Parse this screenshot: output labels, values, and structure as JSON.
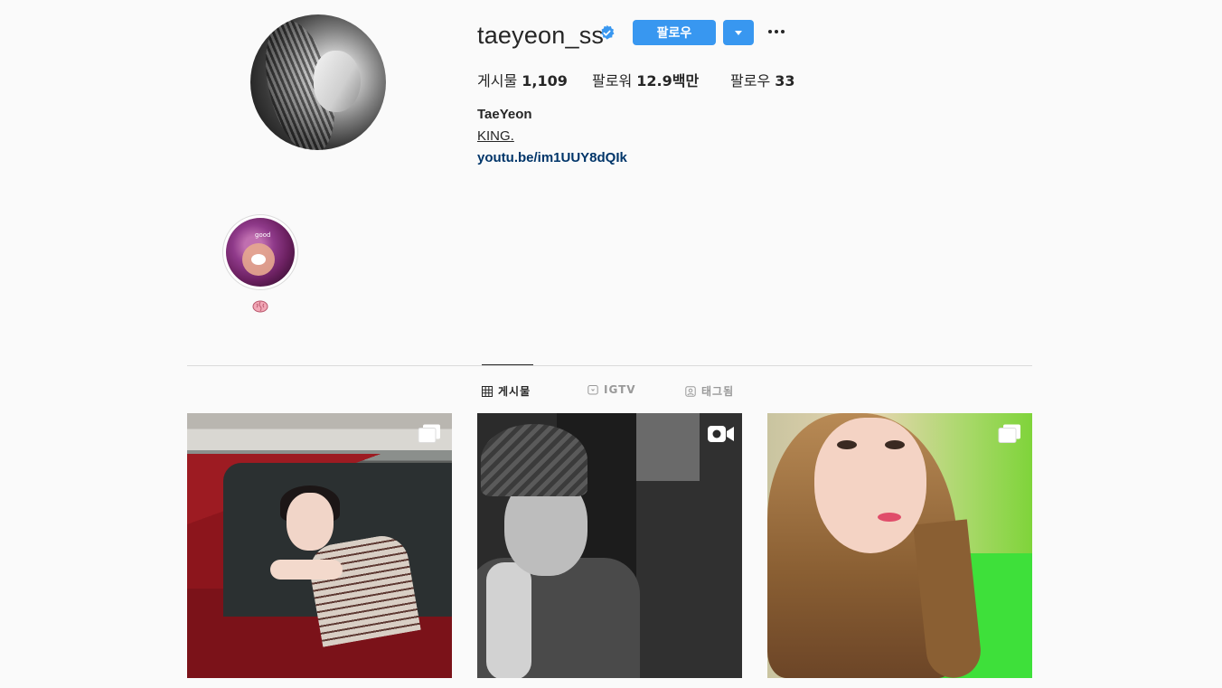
{
  "profile": {
    "username": "taeyeon_ss",
    "follow_label": "팔로우",
    "stats": {
      "posts_label": "게시물",
      "posts_value": "1,109",
      "followers_label": "팔로워",
      "followers_value": "12.9백만",
      "following_label": "팔로우",
      "following_value": "33"
    },
    "full_name": "TaeYeon",
    "bio": "KING.",
    "link": "youtu.be/im1UUY8dQIk"
  },
  "highlight": {
    "image_text": "good",
    "label_icon": "brain-emoji"
  },
  "tabs": [
    {
      "label": "게시물",
      "icon": "grid-icon",
      "active": true
    },
    {
      "label": "IGTV",
      "icon": "igtv-icon",
      "active": false
    },
    {
      "label": "태그됨",
      "icon": "tagged-icon",
      "active": false
    }
  ],
  "posts": [
    {
      "badge": "carousel-icon"
    },
    {
      "badge": "video-icon"
    },
    {
      "badge": "carousel-icon"
    }
  ],
  "colors": {
    "accent": "#3897f0",
    "link": "#003569",
    "verified": "#3897f0"
  }
}
